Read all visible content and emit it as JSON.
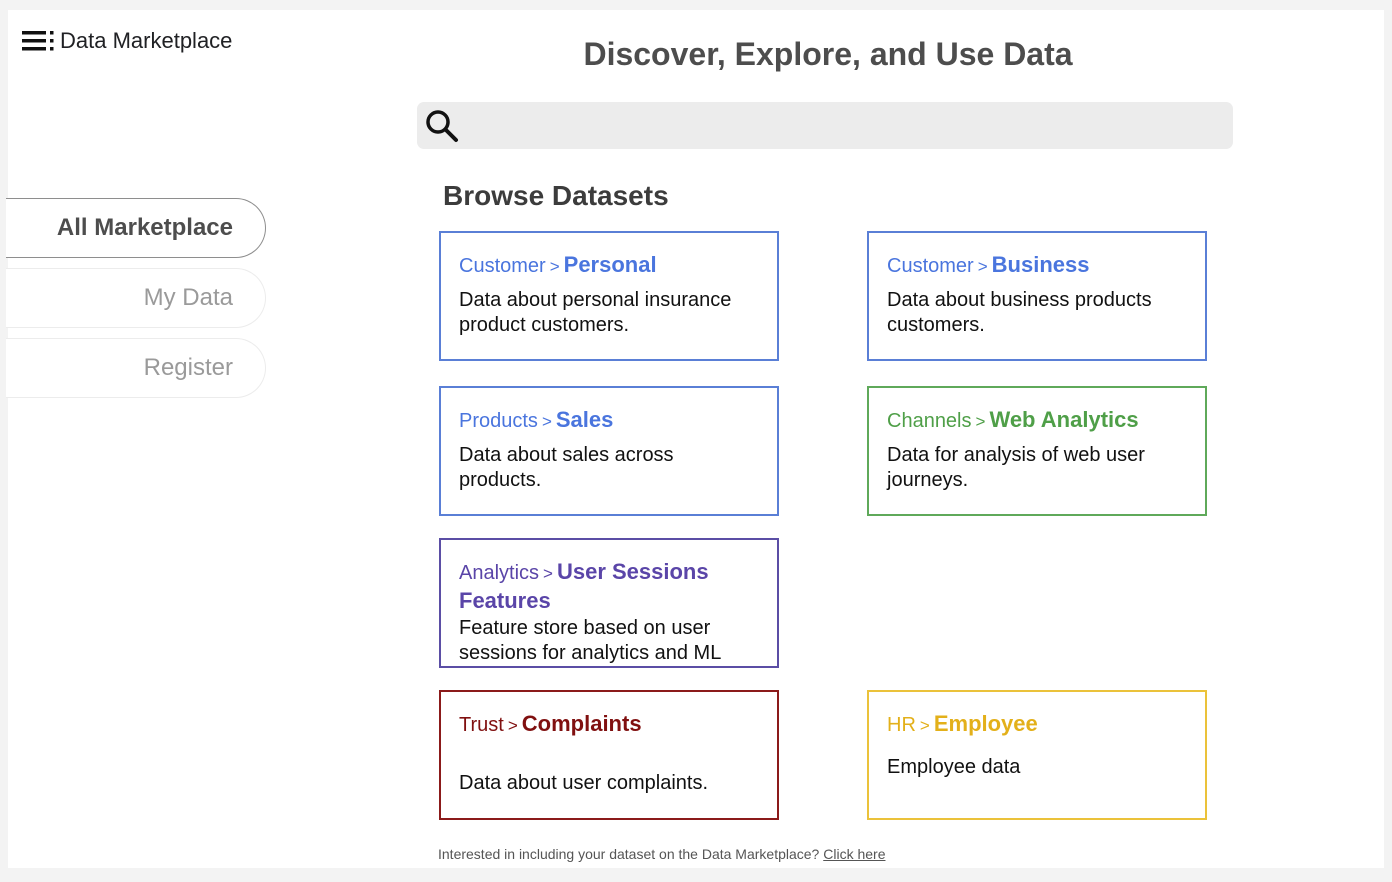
{
  "app": {
    "title": "Data Marketplace",
    "menu_icon": "menu-icon"
  },
  "page_title": "Discover, Explore, and Use Data",
  "search": {
    "icon": "search-icon",
    "value": "",
    "placeholder": ""
  },
  "sidebar": {
    "items": [
      {
        "label": "All Marketplace",
        "active": true
      },
      {
        "label": "My Data",
        "active": false
      },
      {
        "label": "Register",
        "active": false
      }
    ]
  },
  "browse": {
    "title": "Browse Datasets",
    "cards": [
      {
        "category": "Customer",
        "separator": ">",
        "name": "Personal",
        "description": "Data about personal insurance product customers.",
        "color": "#4a75de"
      },
      {
        "category": "Customer",
        "separator": ">",
        "name": "Business",
        "description": "Data about business products  customers.",
        "color": "#4a75de"
      },
      {
        "category": "Products",
        "separator": ">",
        "name": "Sales",
        "description": "Data about sales across products.",
        "color": "#4a75de"
      },
      {
        "category": "Channels",
        "separator": ">",
        "name": "Web Analytics",
        "description": "Data for analysis of web user journeys.",
        "color": "#4f9f48"
      },
      {
        "category": "Analytics",
        "separator": ">",
        "name": "User Sessions Features",
        "description": "Feature store based on user sessions for analytics and ML",
        "color": "#5a45a8"
      },
      {
        "category": "Trust",
        "separator": ">",
        "name": "Complaints",
        "description": "Data about user complaints.",
        "color": "#801010"
      },
      {
        "category": "HR",
        "separator": ">",
        "name": "Employee",
        "description": "Employee data",
        "color": "#e3b01a"
      }
    ]
  },
  "footer": {
    "text": "Interested in including your dataset on the Data Marketplace?",
    "link": "Click here"
  }
}
